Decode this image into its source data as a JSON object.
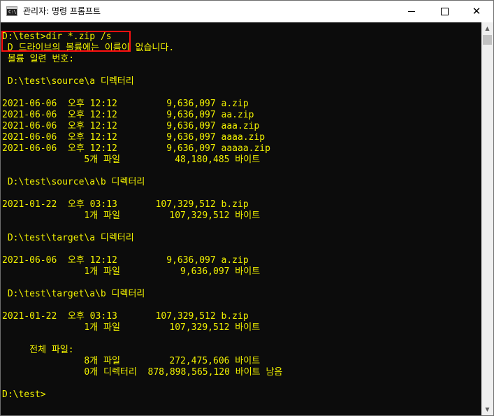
{
  "window": {
    "title": "관리자: 명령 프롬프트",
    "icon": "cmd-icon",
    "icon_text": "C:\\",
    "controls": {
      "minimize": "minimize-icon",
      "maximize": "maximize-icon",
      "close": "close-icon",
      "close_glyph": "✕"
    }
  },
  "console": {
    "text_color": "#f2f200",
    "background": "#0c0c0c",
    "highlight_color": "#ff1010",
    "lines": [
      "D:\\test>dir *.zip /s",
      " D 드라이브의 볼륨에는 이름이 없습니다.",
      " 볼륨 일련 번호:",
      "",
      " D:\\test\\source\\a 디렉터리",
      "",
      "2021-06-06  오후 12:12         9,636,097 a.zip",
      "2021-06-06  오후 12:12         9,636,097 aa.zip",
      "2021-06-06  오후 12:12         9,636,097 aaa.zip",
      "2021-06-06  오후 12:12         9,636,097 aaaa.zip",
      "2021-06-06  오후 12:12         9,636,097 aaaaa.zip",
      "               5개 파일          48,180,485 바이트",
      "",
      " D:\\test\\source\\a\\b 디렉터리",
      "",
      "2021-01-22  오후 03:13       107,329,512 b.zip",
      "               1개 파일         107,329,512 바이트",
      "",
      " D:\\test\\target\\a 디렉터리",
      "",
      "2021-06-06  오후 12:12         9,636,097 a.zip",
      "               1개 파일           9,636,097 바이트",
      "",
      " D:\\test\\target\\a\\b 디렉터리",
      "",
      "2021-01-22  오후 03:13       107,329,512 b.zip",
      "               1개 파일         107,329,512 바이트",
      "",
      "     전체 파일:",
      "               8개 파일         272,475,606 바이트",
      "               0개 디렉터리  878,898,565,120 바이트 남음",
      "",
      "D:\\test>"
    ]
  },
  "scrollbar": {
    "up_icon": "scroll-up-arrow-icon",
    "down_icon": "scroll-down-arrow-icon",
    "up_glyph": "▲",
    "down_glyph": "▼"
  }
}
